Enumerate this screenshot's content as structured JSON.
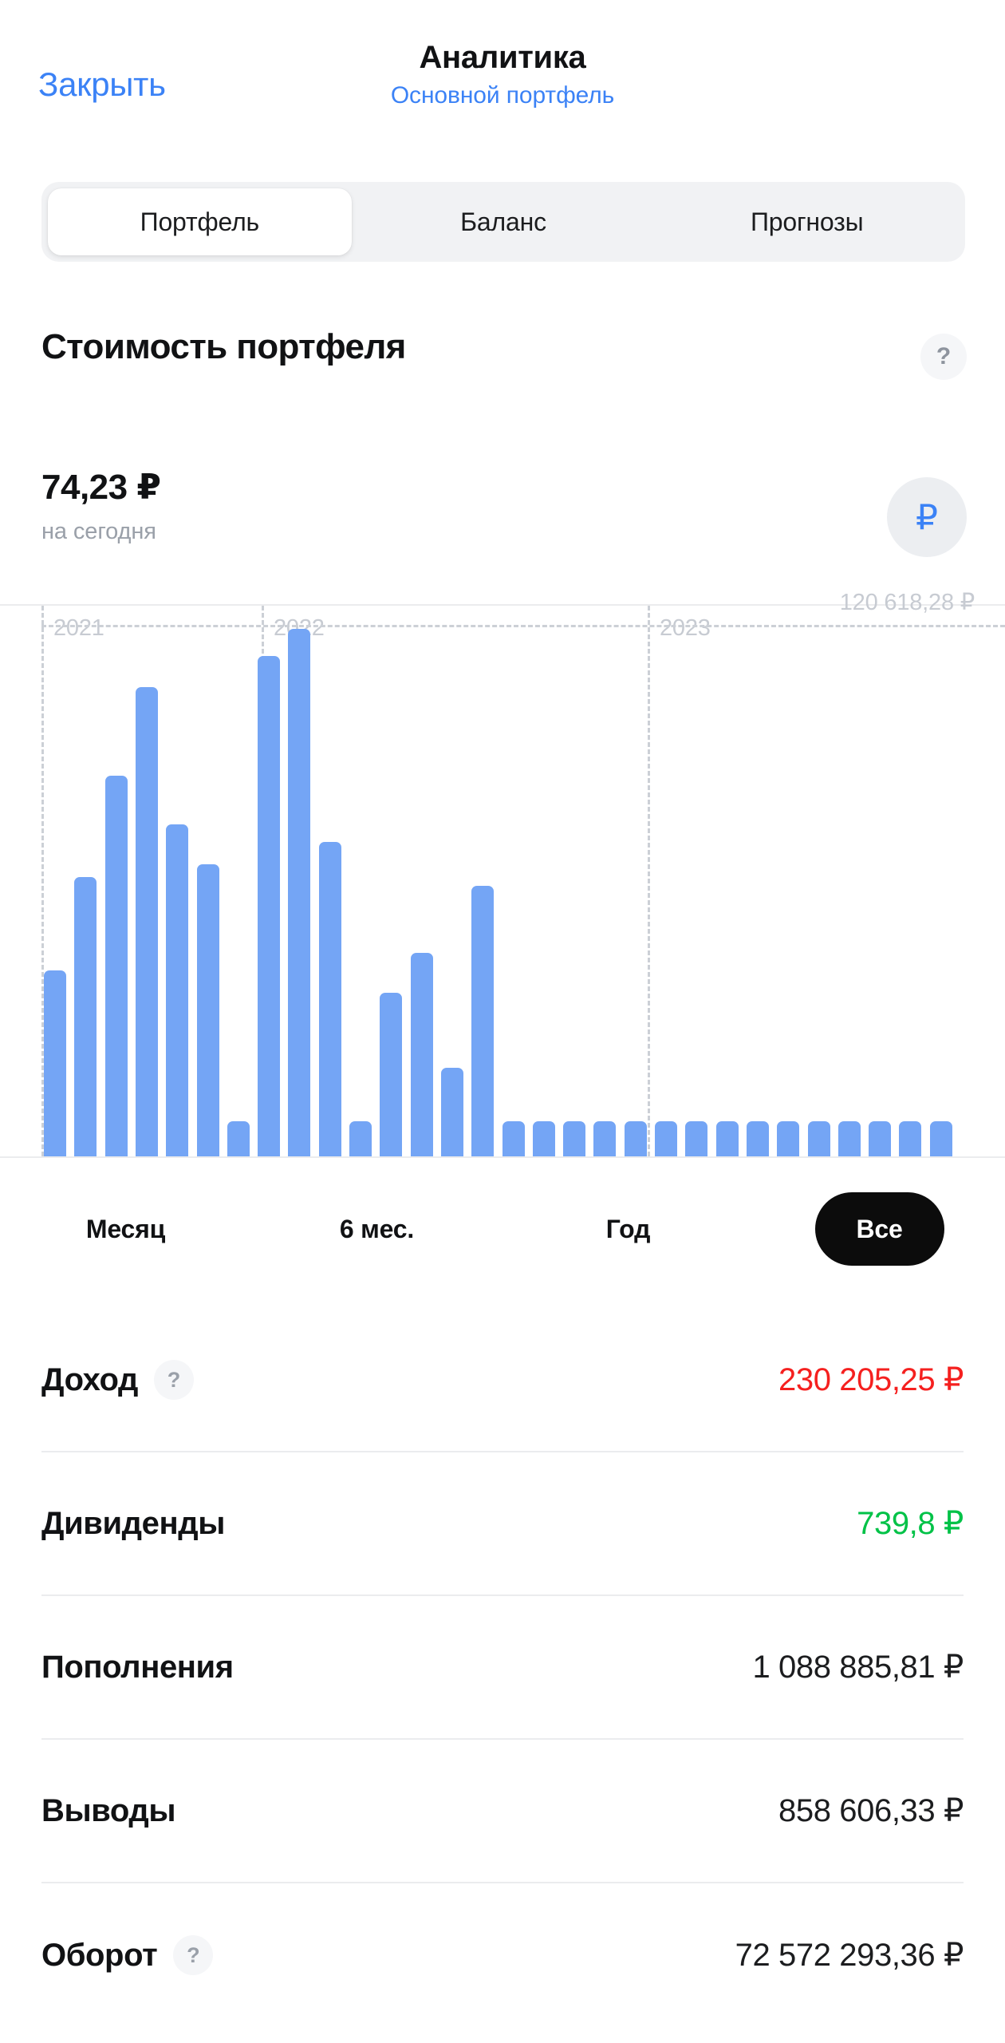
{
  "header": {
    "close_label": "Закрыть",
    "title": "Аналитика",
    "subtitle": "Основной портфель"
  },
  "tabs": [
    {
      "label": "Портфель",
      "active": true
    },
    {
      "label": "Баланс",
      "active": false
    },
    {
      "label": "Прогнозы",
      "active": false
    }
  ],
  "section": {
    "title": "Стоимость портфеля",
    "help_icon": "?",
    "value": "74,23 ₽",
    "value_caption": "на сегодня",
    "currency_icon": "₽"
  },
  "periods": [
    {
      "label": "Месяц",
      "active": false
    },
    {
      "label": "6 мес.",
      "active": false
    },
    {
      "label": "Год",
      "active": false
    },
    {
      "label": "Все",
      "active": true
    }
  ],
  "stats": [
    {
      "label": "Доход",
      "help": "?",
      "value": "230 205,25 ₽",
      "tone": "neg"
    },
    {
      "label": "Дивиденды",
      "help": null,
      "value": "739,8 ₽",
      "tone": "pos"
    },
    {
      "label": "Пополнения",
      "help": null,
      "value": "1 088 885,81 ₽",
      "tone": "neutral"
    },
    {
      "label": "Выводы",
      "help": null,
      "value": "858 606,33 ₽",
      "tone": "neutral"
    },
    {
      "label": "Оборот",
      "help": "?",
      "value": "72 572 293,36 ₽",
      "tone": "neutral"
    }
  ],
  "colors": {
    "accent_blue": "#3b82f6",
    "bar_blue": "#74a5f5",
    "negative_red": "#f5201f",
    "positive_green": "#00c247",
    "grid_gray": "#ccd0d6",
    "pill_black": "#0c0c0c"
  },
  "chart_data": {
    "type": "bar",
    "title": "Стоимость портфеля",
    "xlabel": "",
    "ylabel": "",
    "grid": true,
    "legend": null,
    "reference_line": {
      "label": "120 618,28 ₽",
      "value": 120618.28
    },
    "year_markers": [
      {
        "label": "2021",
        "x_index": 0
      },
      {
        "label": "2022",
        "x_index": 7
      },
      {
        "label": "2023",
        "x_index": 20
      }
    ],
    "ymax": 125000,
    "values": [
      42000,
      63000,
      86000,
      106000,
      75000,
      66000,
      8000,
      113000,
      119000,
      71000,
      8000,
      37000,
      46000,
      20000,
      61000,
      8000,
      8000,
      8000,
      8000,
      8000,
      8000,
      8000,
      8000,
      8000,
      8000,
      8000,
      8000,
      8000,
      8000,
      8000
    ],
    "bar_color": "#74a5f5",
    "bar_count": 30
  }
}
